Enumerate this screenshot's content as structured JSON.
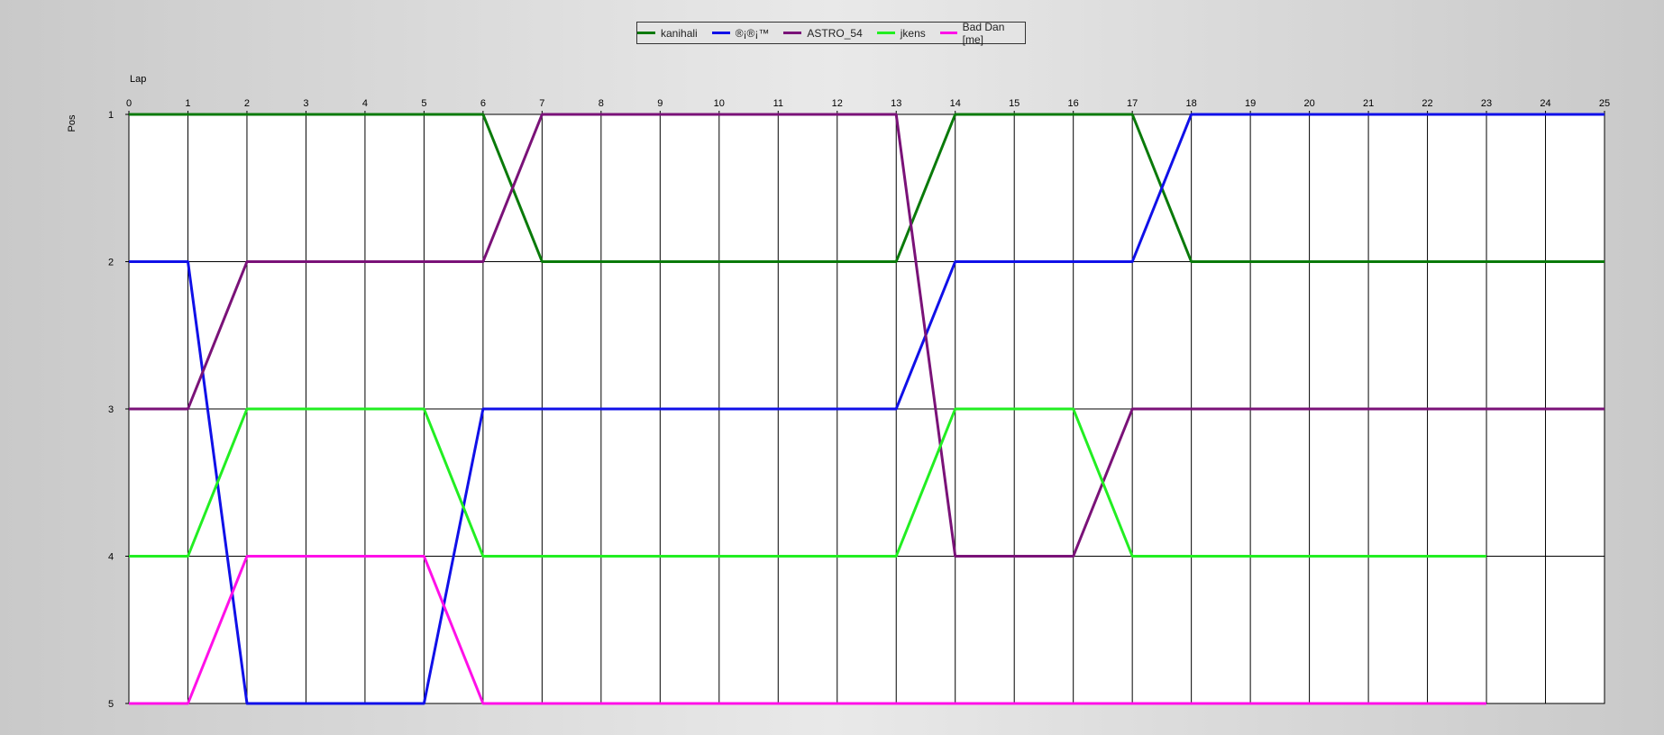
{
  "chart_data": {
    "type": "line",
    "title": "",
    "xlabel": "Lap",
    "ylabel": "Pos",
    "xlim": [
      0,
      25
    ],
    "ylim": [
      1,
      5
    ],
    "y_inverted": true,
    "grid": true,
    "legend_position": "top-center",
    "x_ticks": [
      "0",
      "1",
      "2",
      "3",
      "4",
      "5",
      "6",
      "7",
      "8",
      "9",
      "10",
      "11",
      "12",
      "13",
      "14",
      "15",
      "16",
      "17",
      "18",
      "19",
      "20",
      "21",
      "22",
      "23",
      "24",
      "25"
    ],
    "y_ticks": [
      "1",
      "2",
      "3",
      "4",
      "5"
    ],
    "series": [
      {
        "name": "kanihali",
        "color": "#0a7a0a",
        "x": [
          0,
          1,
          2,
          3,
          4,
          5,
          6,
          7,
          8,
          9,
          10,
          11,
          12,
          13,
          14,
          15,
          16,
          17,
          18,
          19,
          20,
          21,
          22,
          23,
          24,
          25
        ],
        "y": [
          1,
          1,
          1,
          1,
          1,
          1,
          1,
          2,
          2,
          2,
          2,
          2,
          2,
          2,
          1,
          1,
          1,
          1,
          2,
          2,
          2,
          2,
          2,
          2,
          2,
          2
        ]
      },
      {
        "name": "®¡®¡™",
        "color": "#1010e8",
        "x": [
          0,
          1,
          2,
          3,
          4,
          5,
          6,
          7,
          8,
          9,
          10,
          11,
          12,
          13,
          14,
          15,
          16,
          17,
          18,
          19,
          20,
          21,
          22,
          23,
          24,
          25
        ],
        "y": [
          2,
          2,
          5,
          5,
          5,
          5,
          3,
          3,
          3,
          3,
          3,
          3,
          3,
          3,
          2,
          2,
          2,
          2,
          1,
          1,
          1,
          1,
          1,
          1,
          1,
          1
        ]
      },
      {
        "name": "ASTRO_54",
        "color": "#7a1278",
        "x": [
          0,
          1,
          2,
          3,
          4,
          5,
          6,
          7,
          8,
          9,
          10,
          11,
          12,
          13,
          14,
          15,
          16,
          17,
          18,
          19,
          20,
          21,
          22,
          23,
          24,
          25
        ],
        "y": [
          3,
          3,
          2,
          2,
          2,
          2,
          2,
          1,
          1,
          1,
          1,
          1,
          1,
          1,
          4,
          4,
          4,
          3,
          3,
          3,
          3,
          3,
          3,
          3,
          3,
          3
        ]
      },
      {
        "name": "jkens",
        "color": "#22ee22",
        "x": [
          0,
          1,
          2,
          3,
          4,
          5,
          6,
          7,
          8,
          9,
          10,
          11,
          12,
          13,
          14,
          15,
          16,
          17,
          18,
          19,
          20,
          21,
          22,
          23
        ],
        "y": [
          4,
          4,
          3,
          3,
          3,
          3,
          4,
          4,
          4,
          4,
          4,
          4,
          4,
          4,
          3,
          3,
          3,
          4,
          4,
          4,
          4,
          4,
          4,
          4
        ]
      },
      {
        "name": "Bad Dan [me]",
        "color": "#ff10e8",
        "x": [
          0,
          1,
          2,
          3,
          4,
          5,
          6,
          7,
          8,
          9,
          10,
          11,
          12,
          13,
          14,
          15,
          16,
          17,
          18,
          19,
          20,
          21,
          22,
          23
        ],
        "y": [
          5,
          5,
          4,
          4,
          4,
          4,
          5,
          5,
          5,
          5,
          5,
          5,
          5,
          5,
          5,
          5,
          5,
          5,
          5,
          5,
          5,
          5,
          5,
          5
        ]
      }
    ]
  }
}
